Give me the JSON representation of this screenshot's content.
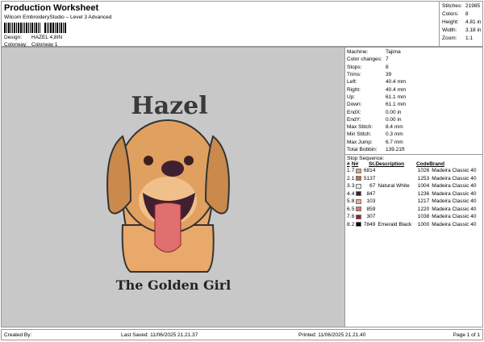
{
  "header": {
    "title": "Production Worksheet",
    "subtitle": "Wilcom EmbroideryStudio – Level 3 Advanced",
    "design_label": "Design:",
    "design": "HAZEL 4,8IN",
    "colorway_label": "Colorway:",
    "colorway": "Colorway 1"
  },
  "summary": [
    {
      "k": "Stitches:",
      "v": "21985"
    },
    {
      "k": "Colors:",
      "v": "8"
    },
    {
      "k": "Height:",
      "v": "4.81 in"
    },
    {
      "k": "Width:",
      "v": "3.18 in"
    },
    {
      "k": "Zoom:",
      "v": "1:1"
    }
  ],
  "design_image": {
    "top_text": "Hazel",
    "bottom_text": "The Golden Girl"
  },
  "details": [
    {
      "k": "Machine:",
      "v": "Tajima"
    },
    {
      "k": "Color changes:",
      "v": "7"
    },
    {
      "k": "Stops:",
      "v": "8"
    },
    {
      "k": "Trims:",
      "v": "39"
    },
    {
      "k": "Left:",
      "v": "40.4 mm"
    },
    {
      "k": "Right:",
      "v": "40.4 mm"
    },
    {
      "k": "Up:",
      "v": "61.1 mm"
    },
    {
      "k": "Down:",
      "v": "61.1 mm"
    },
    {
      "k": "EndX:",
      "v": "0.00 in"
    },
    {
      "k": "EndY:",
      "v": "0.00 in"
    },
    {
      "k": "Max Stitch:",
      "v": "8.4 mm"
    },
    {
      "k": "Min Stitch:",
      "v": "0.3 mm"
    },
    {
      "k": "Max Jump:",
      "v": "6.7 mm"
    },
    {
      "k": "Total Bobbin:",
      "v": "139.21ft"
    }
  ],
  "stop_sequence": {
    "title": "Stop Sequence:",
    "headers": [
      "#",
      "N#",
      "St.",
      "Description",
      "Code",
      "Brand"
    ],
    "rows": [
      {
        "n": "1.",
        "nn": "7",
        "color": "#e8a070",
        "st": "6814",
        "desc": "",
        "code": "1026",
        "brand": "Madeira Classic 40"
      },
      {
        "n": "2.",
        "nn": "1",
        "color": "#c87040",
        "st": "5137",
        "desc": "",
        "code": "1253",
        "brand": "Madeira Classic 40"
      },
      {
        "n": "3.",
        "nn": "3",
        "color": "#e8e8ee",
        "st": "67",
        "desc": "Natural White",
        "code": "1004",
        "brand": "Madeira Classic 40"
      },
      {
        "n": "4.",
        "nn": "4",
        "color": "#402030",
        "st": "847",
        "desc": "",
        "code": "1236",
        "brand": "Madeira Classic 40"
      },
      {
        "n": "5.",
        "nn": "8",
        "color": "#f0a890",
        "st": "103",
        "desc": "",
        "code": "1217",
        "brand": "Madeira Classic 40"
      },
      {
        "n": "6.",
        "nn": "5",
        "color": "#e07070",
        "st": "859",
        "desc": "",
        "code": "1220",
        "brand": "Madeira Classic 40"
      },
      {
        "n": "7.",
        "nn": "6",
        "color": "#902030",
        "st": "307",
        "desc": "",
        "code": "1038",
        "brand": "Madeira Classic 40"
      },
      {
        "n": "8.",
        "nn": "2",
        "color": "#000000",
        "st": "7849",
        "desc": "Emerald Black",
        "code": "1000",
        "brand": "Madeira Classic 40"
      }
    ]
  },
  "footer": {
    "created": "Created By:",
    "saved": "Last Saved: 11/06/2025 21.21.37",
    "printed": "Printed: 11/06/2025 21.21.40",
    "page": "Page 1 of 1"
  }
}
